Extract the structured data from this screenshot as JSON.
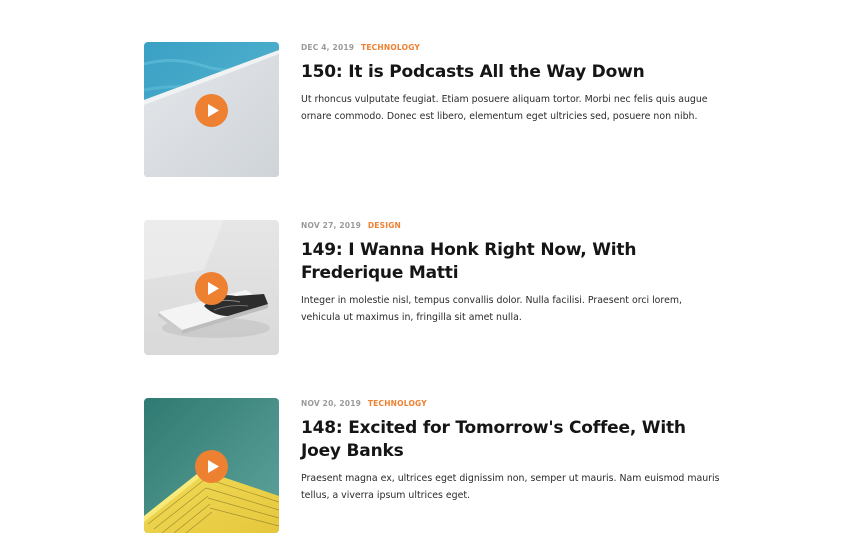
{
  "accent_color": "#ee8031",
  "episodes": [
    {
      "date": "DEC 4, 2019",
      "category": "TECHNOLOGY",
      "title": "150: It is Podcasts All the Way Down",
      "description": "Ut rhoncus vulputate feugiat. Etiam posuere aliquam tortor. Morbi nec felis quis augue ornare commodo. Donec est libero, elementum eget ultricies sed, posuere non nibh.",
      "thumbnail_icon": "pool-edge-image",
      "play_icon": "play-icon"
    },
    {
      "date": "NOV 27, 2019",
      "category": "DESIGN",
      "title": "149: I Wanna Honk Right Now, With Frederique Matti",
      "description": "Integer in molestie nisl, tempus convallis dolor. Nulla facilisi. Praesent orci lorem, vehicula ut maximus in, fringilla sit amet nulla.",
      "thumbnail_icon": "book-image",
      "play_icon": "play-icon"
    },
    {
      "date": "NOV 20, 2019",
      "category": "TECHNOLOGY",
      "title": "148: Excited for Tomorrow's Coffee, With Joey Banks",
      "description": "Praesent magna ex, ultrices eget dignissim non, semper ut mauris. Nam euismod mauris tellus, a viverra ipsum ultrices eget.",
      "thumbnail_icon": "yellow-building-image",
      "play_icon": "play-icon"
    }
  ]
}
